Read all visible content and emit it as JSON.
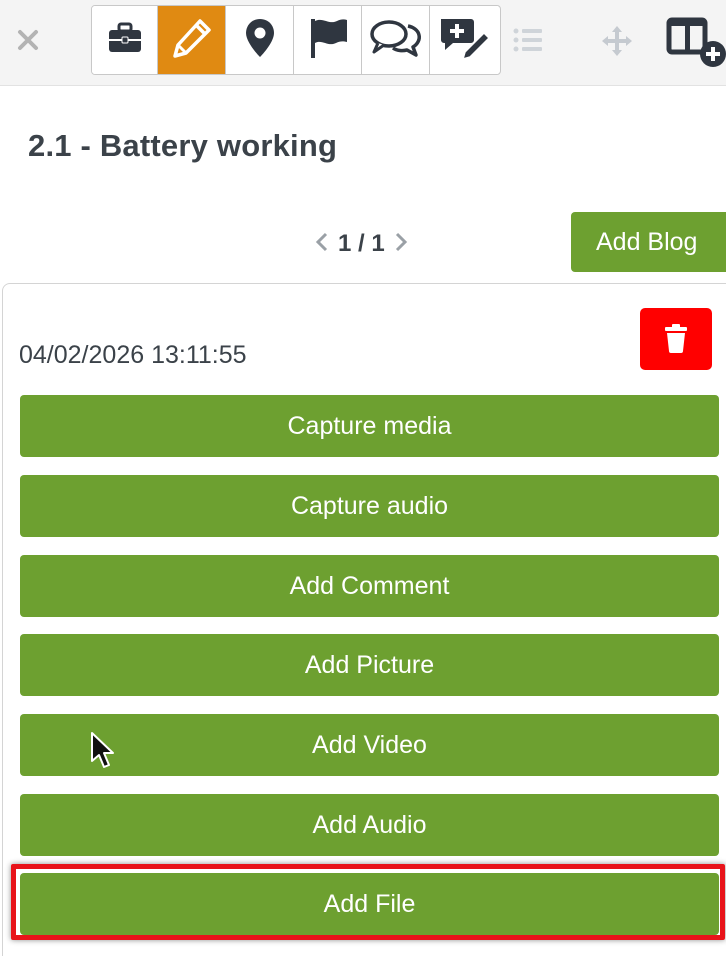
{
  "toolbar": {
    "close_icon": "close-icon",
    "tools": [
      {
        "name": "briefcase-icon",
        "active": false
      },
      {
        "name": "pencil-icon",
        "active": true
      },
      {
        "name": "map-pin-icon",
        "active": false
      },
      {
        "name": "flag-icon",
        "active": false
      },
      {
        "name": "comments-icon",
        "active": false
      },
      {
        "name": "add-note-icon",
        "active": false
      }
    ],
    "extra_icons": [
      "list-icon",
      "move-icon",
      "add-column-layout-icon"
    ]
  },
  "page": {
    "title": "2.1 - Battery working"
  },
  "pager": {
    "text": "1 / 1"
  },
  "add_blog_label": "Add Blog",
  "entry": {
    "timestamp": "04/02/2026 13:11:55",
    "actions": [
      {
        "label": "Capture media"
      },
      {
        "label": "Capture audio"
      },
      {
        "label": "Add Comment"
      },
      {
        "label": "Add Picture"
      },
      {
        "label": "Add Video"
      },
      {
        "label": "Add Audio"
      },
      {
        "label": "Add File"
      }
    ]
  },
  "colors": {
    "accent_green": "#6da030",
    "active_orange": "#e08a12",
    "delete_red": "#ff0000",
    "highlight_red": "#e8131a"
  }
}
